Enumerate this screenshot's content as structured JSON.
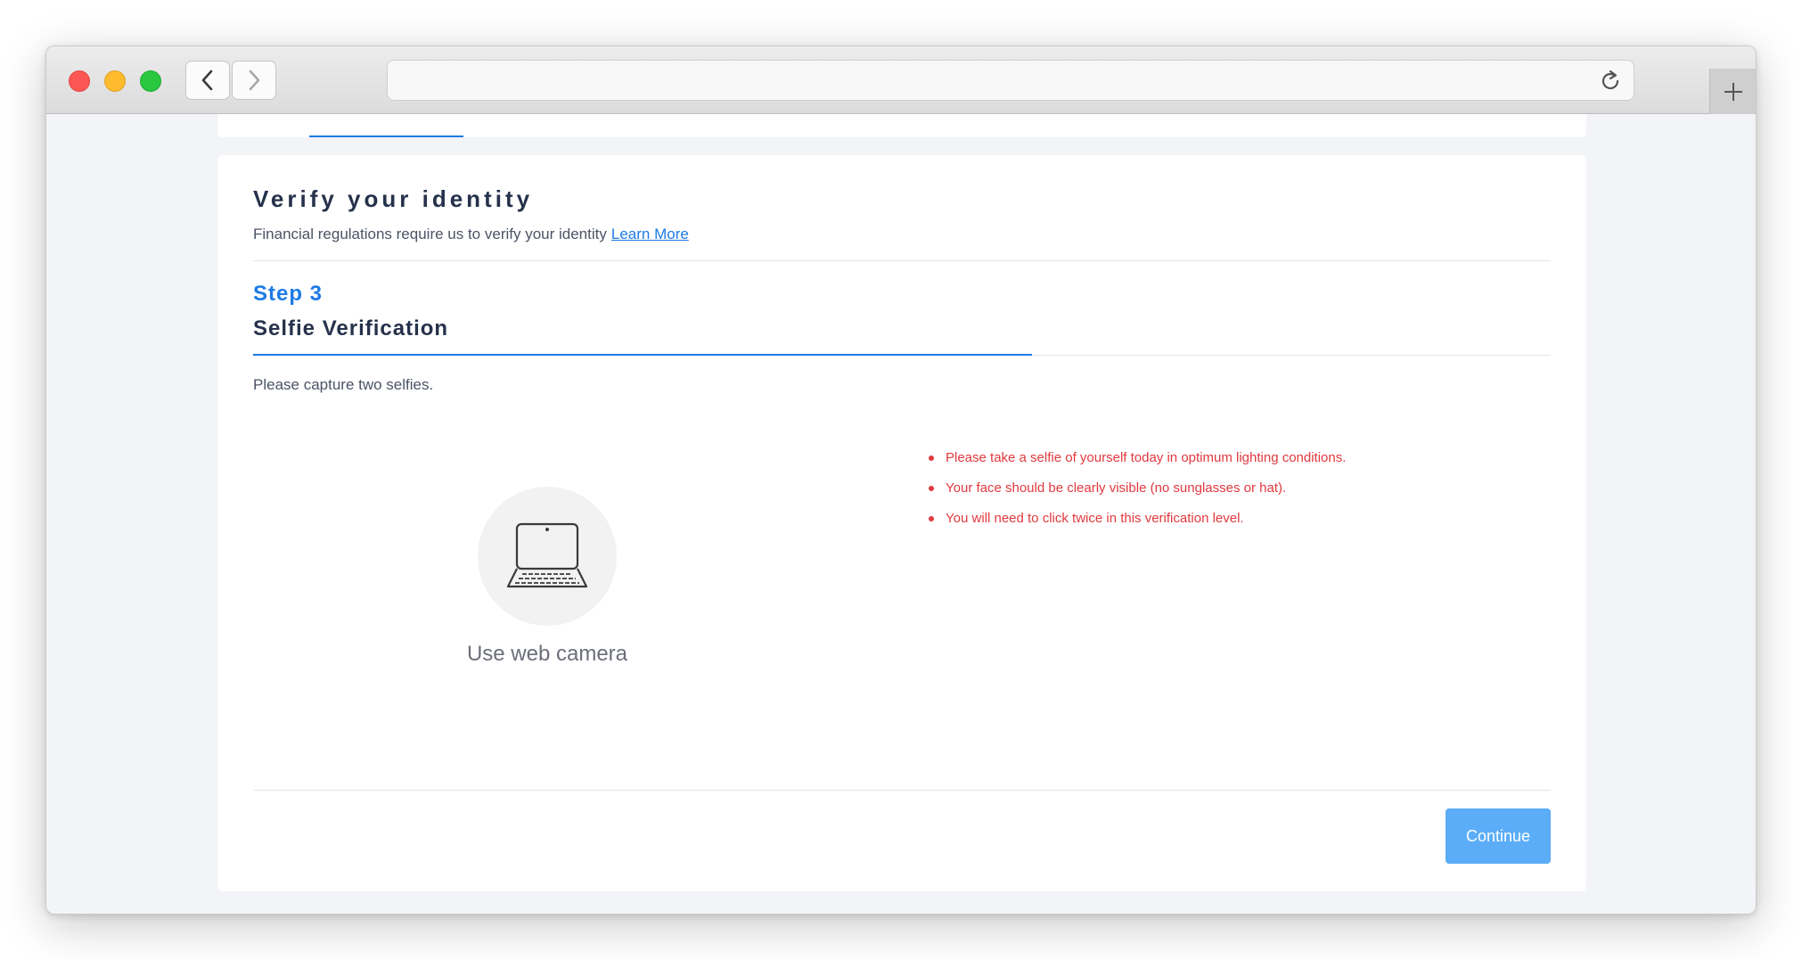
{
  "browser": {
    "url": ""
  },
  "verify": {
    "title": "Verify your identity",
    "subtitle": "Financial regulations require us to verify your identity",
    "learn_more": "Learn More"
  },
  "step": {
    "label": "Step 3",
    "title": "Selfie Verification",
    "instruction": "Please capture two selfies.",
    "progress_fraction": 0.6
  },
  "camera_option": {
    "icon": "laptop-icon",
    "label": "Use web camera"
  },
  "tips": [
    "Please take a selfie of yourself today in optimum lighting conditions.",
    "Your face should be clearly visible (no sunglasses or hat).",
    "You will need to click twice in this verification level."
  ],
  "actions": {
    "continue_label": "Continue"
  },
  "colors": {
    "accent": "#1e7be6",
    "button": "#5badf7",
    "warning": "#e0393e",
    "heading": "#26324b"
  }
}
